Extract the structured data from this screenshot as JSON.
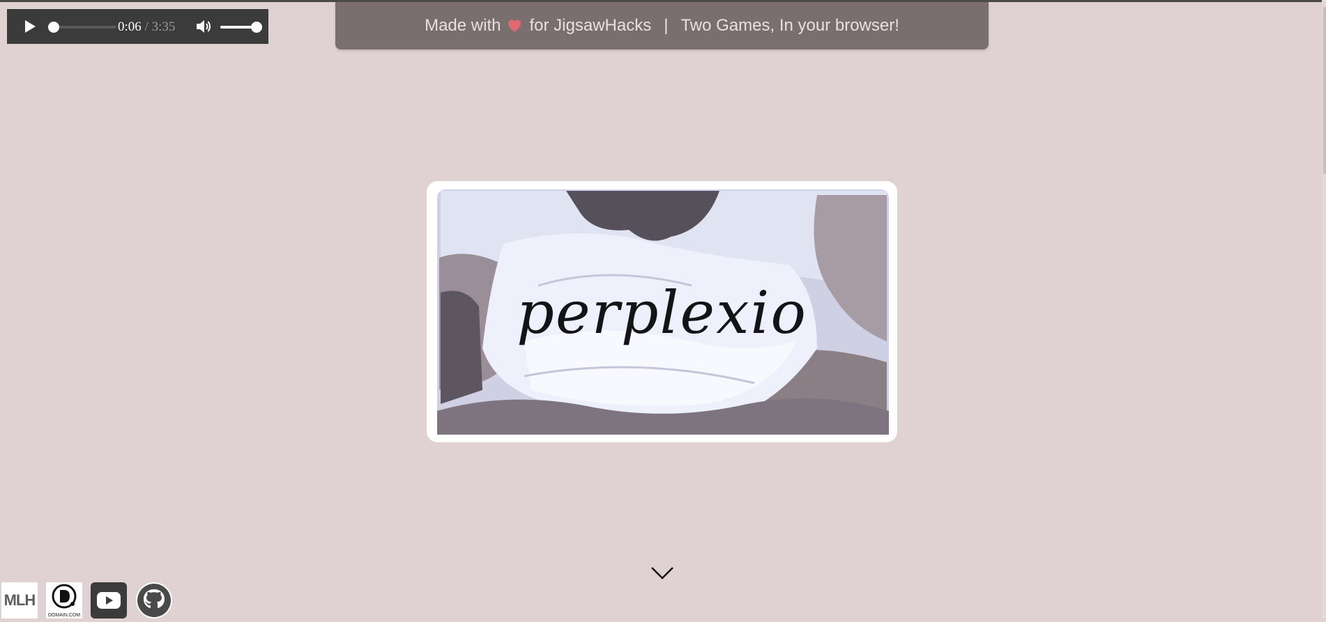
{
  "player": {
    "current_time": "0:06",
    "separator": "/",
    "duration": "3:35",
    "progress": 0.028,
    "volume": 1.0,
    "play_icon": "play-icon",
    "volume_icon": "speaker-icon"
  },
  "banner": {
    "made_with": "Made with",
    "heart_icon": "heart-icon",
    "for_text": "for JigsawHacks",
    "separator": "|",
    "tagline": "Two Games, In your browser!"
  },
  "hero": {
    "title": "perplexio"
  },
  "scroll_icon": "chevron-down-icon",
  "sponsors": [
    {
      "name": "mlh",
      "text": "MLH"
    },
    {
      "name": "domain",
      "text": "DOMAIN.COM"
    },
    {
      "name": "youtube",
      "icon": "youtube-icon"
    },
    {
      "name": "github",
      "icon": "github-icon"
    }
  ],
  "colors": {
    "page_bg": "#e0d2d2",
    "banner_bg": "#7a6f6e",
    "player_bg": "#3b3b3b",
    "heart": "#e06a72"
  }
}
